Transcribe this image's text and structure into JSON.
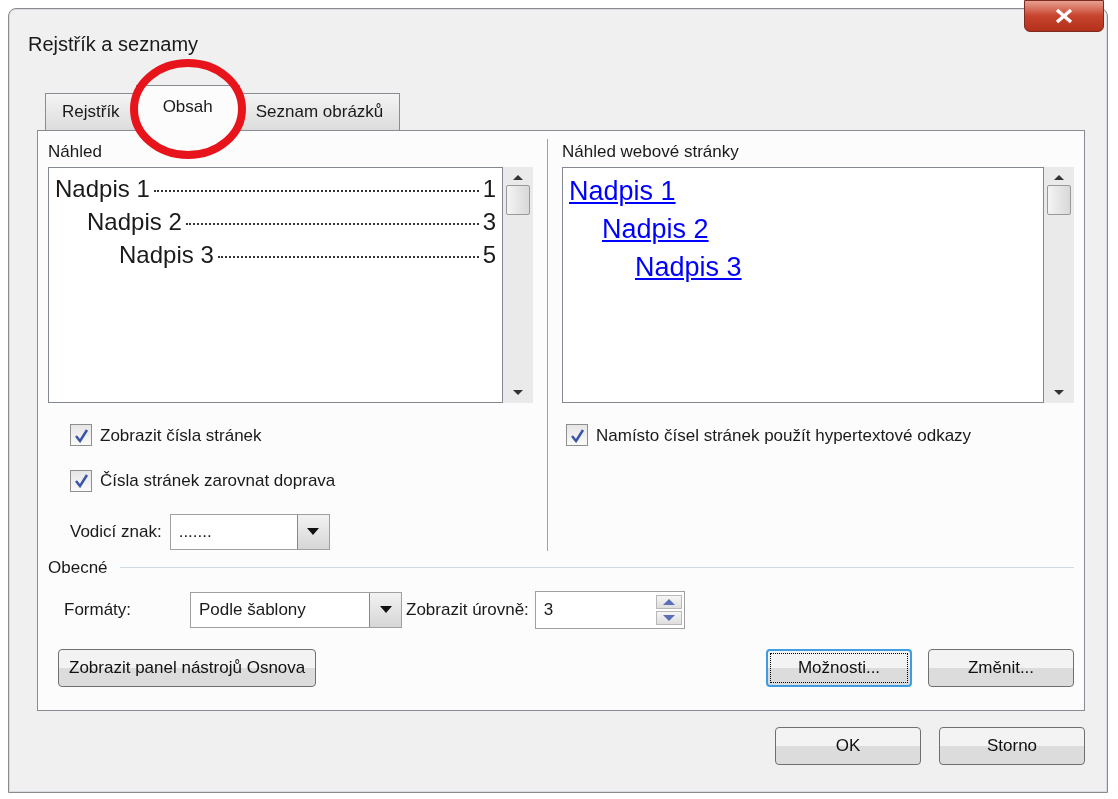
{
  "window": {
    "title": "Rejstřík a seznamy"
  },
  "tabs": [
    {
      "label": "Rejstřík",
      "selected": false
    },
    {
      "label": "Obsah",
      "selected": true
    },
    {
      "label": "Seznam obrázků",
      "selected": false
    }
  ],
  "print_preview": {
    "label": "Náhled",
    "entries": [
      {
        "text": "Nadpis 1",
        "page": "1",
        "children": [
          {
            "text": "Nadpis 2",
            "page": "3",
            "children": [
              {
                "text": "Nadpis 3",
                "page": "5"
              }
            ]
          }
        ]
      }
    ]
  },
  "web_preview": {
    "label": "Náhled webové stránky",
    "entries": [
      {
        "text": "Nadpis 1",
        "children": [
          {
            "text": "Nadpis 2",
            "children": [
              {
                "text": "Nadpis 3"
              }
            ]
          }
        ]
      }
    ]
  },
  "print_options": [
    {
      "label": "Zobrazit čísla stránek",
      "checked": true
    },
    {
      "label": "Čísla stránek zarovnat doprava",
      "checked": true
    }
  ],
  "leader": {
    "label": "Vodicí znak:",
    "value": "......."
  },
  "web_options": [
    {
      "label": "Namísto čísel stránek použít hypertextové odkazy",
      "checked": true
    }
  ],
  "general": {
    "label": "Obecné",
    "formats": {
      "label": "Formáty:",
      "value": "Podle šablony"
    },
    "levels": {
      "label": "Zobrazit úrovně:",
      "value": "3"
    }
  },
  "panel_buttons": [
    {
      "label": "Zobrazit panel nástrojů Osnova",
      "focused": false
    },
    {
      "label": "Možnosti...",
      "focused": true
    },
    {
      "label": "Změnit...",
      "focused": false
    }
  ],
  "footer_buttons": [
    "OK",
    "Storno"
  ]
}
